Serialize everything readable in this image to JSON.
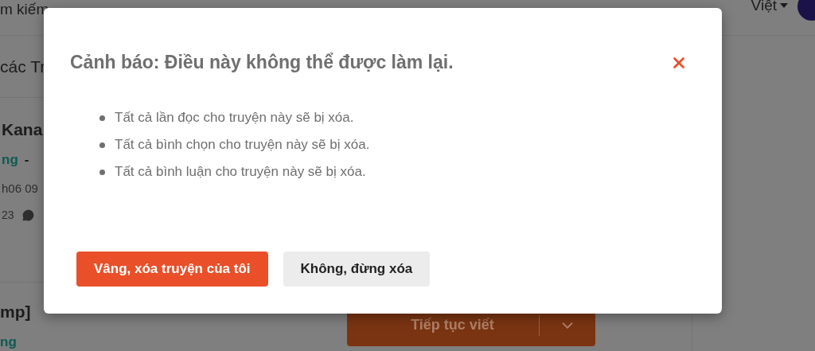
{
  "header": {
    "search_text": "m kiếm",
    "language": "Việt"
  },
  "page": {
    "section_title": "các Tr",
    "stories": [
      {
        "title": "Kana",
        "status": "ng",
        "separator": "-",
        "date": "h06 09",
        "count": "23"
      },
      {
        "title": "mp]",
        "status": "ng"
      }
    ],
    "continue_button": "Tiếp tục viết"
  },
  "dialog": {
    "title": "Cảnh báo: Điều này không thể được làm lại.",
    "items": [
      "Tất cả lần đọc cho truyện này sẽ bị xóa.",
      "Tất cả bình chọn cho truyện này sẽ bị xóa.",
      "Tất cả bình luận cho truyện này sẽ bị xóa."
    ],
    "buttons": [
      {
        "label": "Vâng, xóa truyện của tôi",
        "kind": "primary"
      },
      {
        "label": "Không, đừng xóa",
        "kind": "secondary"
      }
    ]
  }
}
